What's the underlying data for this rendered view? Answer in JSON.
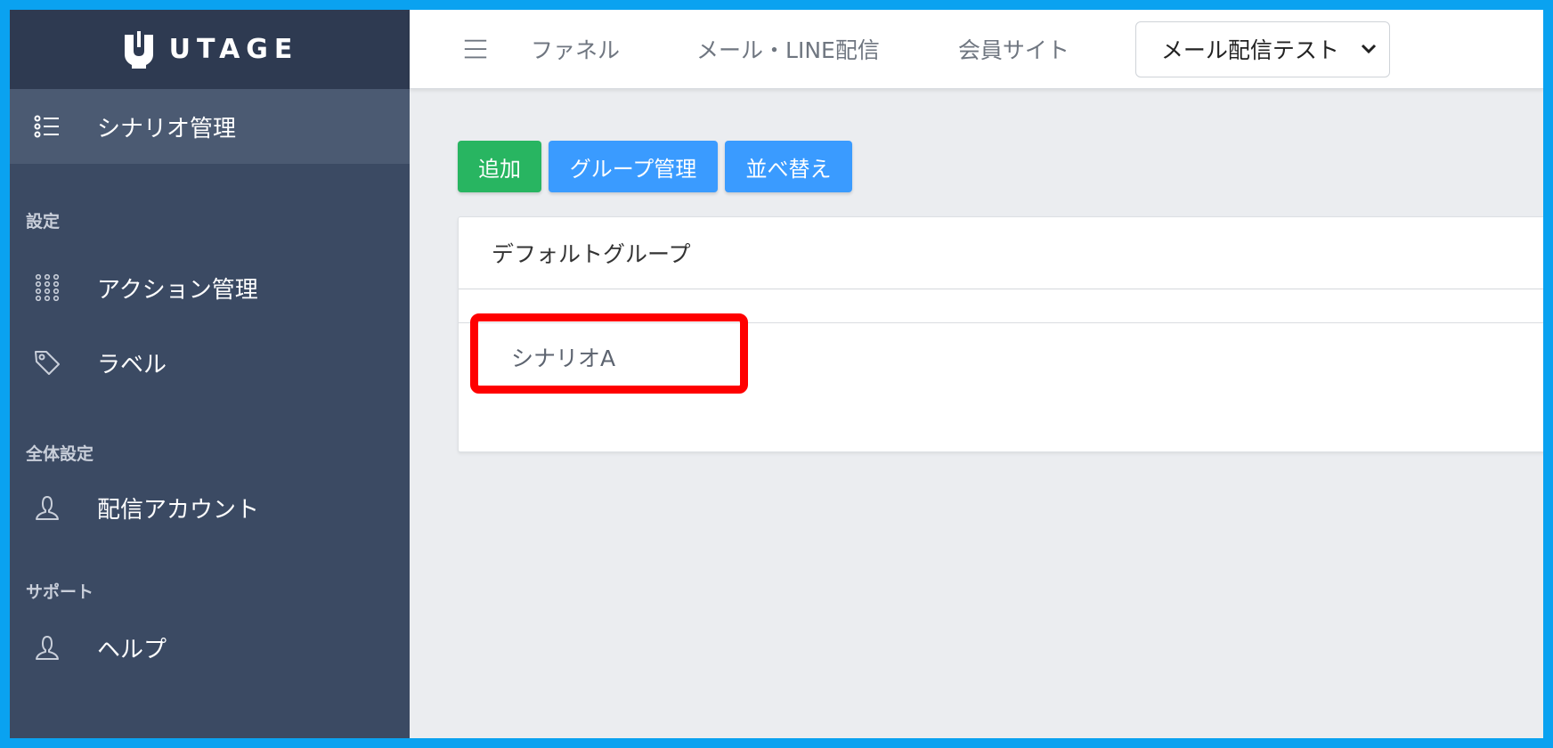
{
  "app": {
    "logo_text": "UTAGE"
  },
  "sidebar": {
    "active_item": {
      "label": "シナリオ管理",
      "icon": "list-icon"
    },
    "sections": [
      {
        "label": "設定",
        "items": [
          {
            "label": "アクション管理",
            "icon": "grid-dots-icon"
          },
          {
            "label": "ラベル",
            "icon": "tag-icon"
          }
        ]
      },
      {
        "label": "全体設定",
        "items": [
          {
            "label": "配信アカウント",
            "icon": "user-icon"
          }
        ]
      },
      {
        "label": "サポート",
        "items": [
          {
            "label": "ヘルプ",
            "icon": "user-icon"
          }
        ]
      }
    ]
  },
  "topbar": {
    "links": [
      "ファネル",
      "メール・LINE配信",
      "会員サイト"
    ],
    "account_select": {
      "value": "メール配信テスト"
    }
  },
  "toolbar": {
    "add_label": "追加",
    "group_manage_label": "グループ管理",
    "reorder_label": "並べ替え"
  },
  "group": {
    "title": "デフォルトグループ",
    "scenarios": [
      "シナリオA"
    ]
  },
  "colors": {
    "sidebar_bg": "#3b4a63",
    "sidebar_header_bg": "#2e3a51",
    "add_button": "#28b561",
    "blue_button": "#3a9bff",
    "highlight": "#ff0000",
    "frame_border": "#0aa2f0"
  }
}
